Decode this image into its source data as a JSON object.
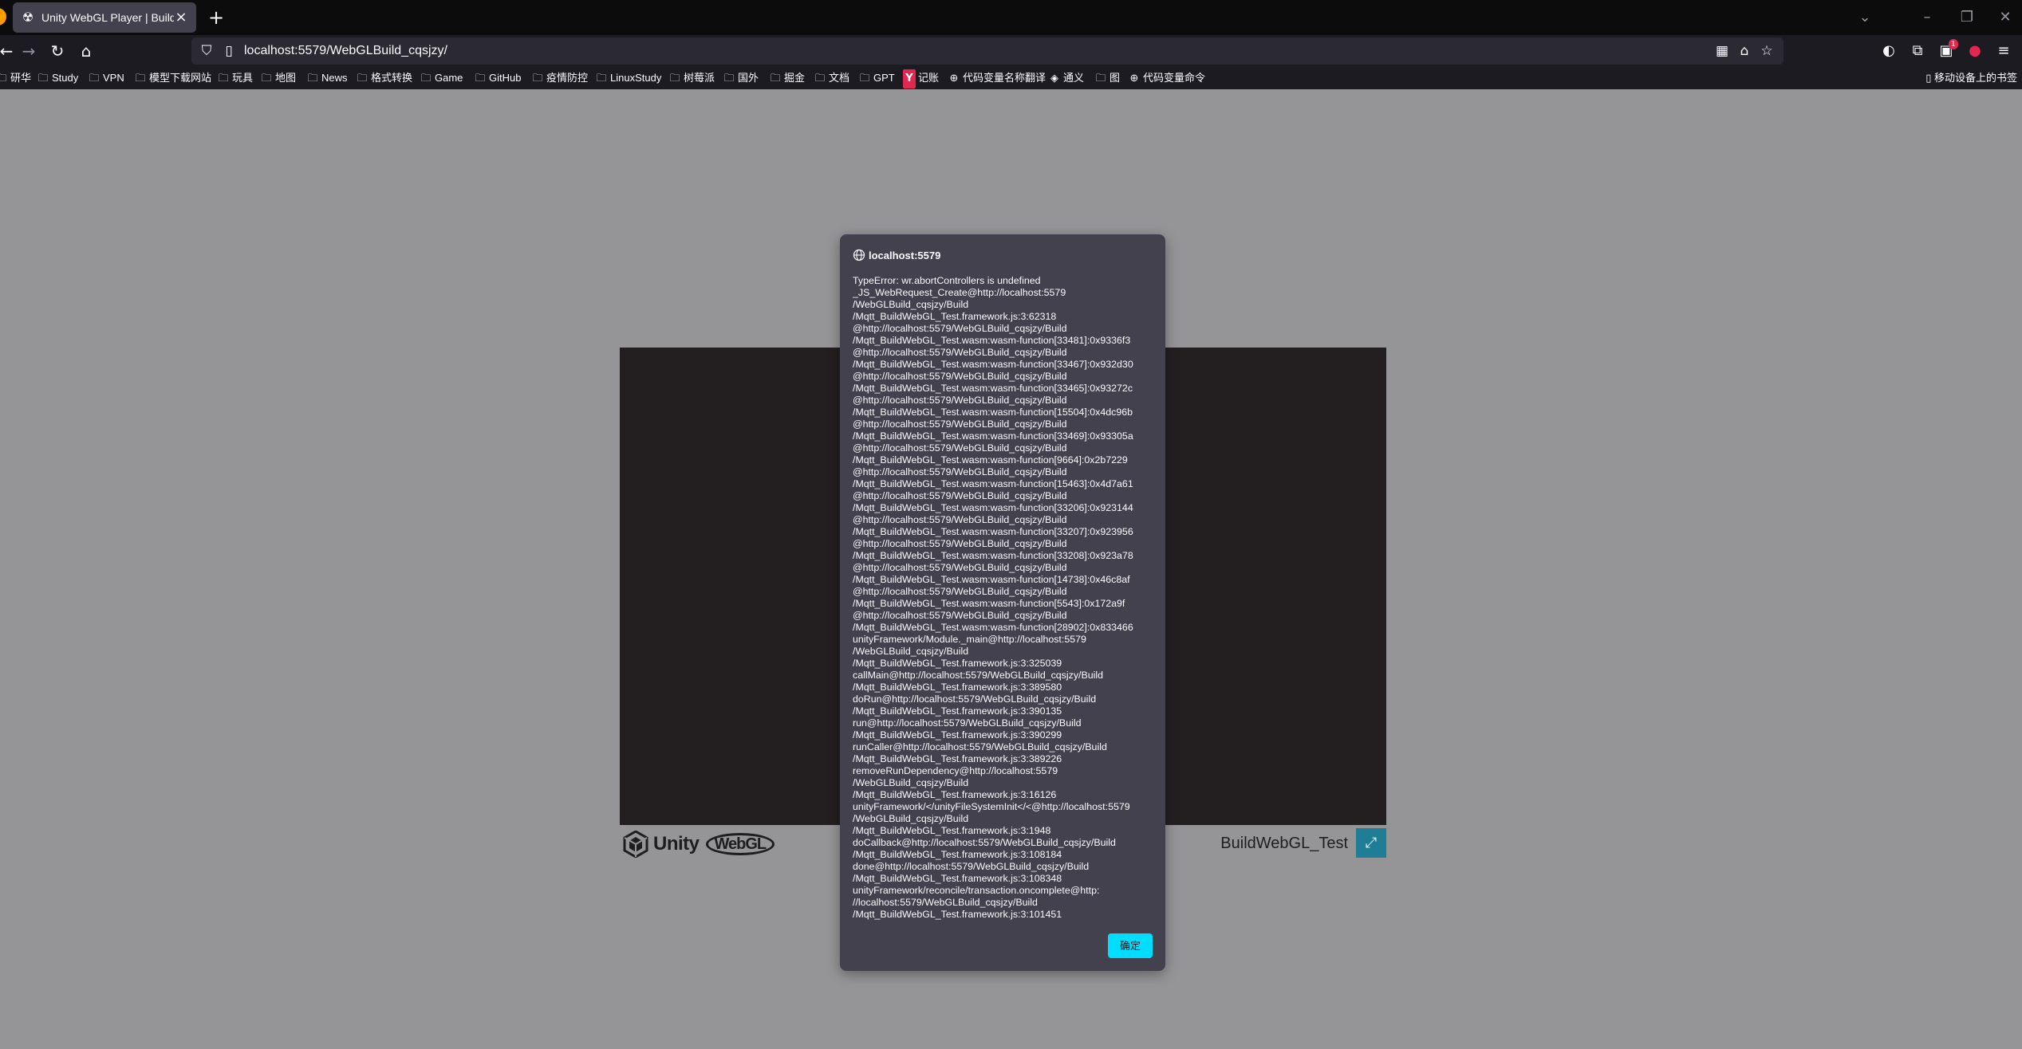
{
  "browser": {
    "tab": {
      "title": "Unity WebGL Player | BuildWebGL_Test",
      "favicon": "unity-icon"
    },
    "url": "localhost:5579/WebGLBuild_cqsjzy/",
    "toolbar_badge": "1",
    "bookmarks": [
      {
        "label": "研华",
        "icon": "folder-icon"
      },
      {
        "label": "Study",
        "icon": "folder-icon"
      },
      {
        "label": "VPN",
        "icon": "folder-icon"
      },
      {
        "label": "模型下载网站",
        "icon": "folder-icon"
      },
      {
        "label": "玩具",
        "icon": "folder-icon"
      },
      {
        "label": "地图",
        "icon": "folder-icon"
      },
      {
        "label": "News",
        "icon": "folder-icon"
      },
      {
        "label": "格式转换",
        "icon": "folder-icon"
      },
      {
        "label": "Game",
        "icon": "folder-icon"
      },
      {
        "label": "GitHub",
        "icon": "folder-icon"
      },
      {
        "label": "疫情防控",
        "icon": "folder-icon"
      },
      {
        "label": "LinuxStudy",
        "icon": "folder-icon"
      },
      {
        "label": "树莓派",
        "icon": "folder-icon"
      },
      {
        "label": "国外",
        "icon": "folder-icon"
      },
      {
        "label": "掘金",
        "icon": "folder-icon"
      },
      {
        "label": "文档",
        "icon": "folder-icon"
      },
      {
        "label": "GPT",
        "icon": "folder-icon"
      },
      {
        "label": "记账",
        "icon": "y-icon"
      },
      {
        "label": "代码变量名称翻译",
        "icon": "globe-icon"
      },
      {
        "label": "通义",
        "icon": "tongyi-icon"
      },
      {
        "label": "图",
        "icon": "folder-icon"
      },
      {
        "label": "代码变量命令",
        "icon": "globe-icon"
      }
    ],
    "mobile_bookmarks": "移动设备上的书签"
  },
  "page": {
    "unity_text": "Unity",
    "webgl_text": "WebGL",
    "build_title": "BuildWebGL_Test"
  },
  "dialog": {
    "title": "localhost:5579",
    "message": "TypeError: wr.abortControllers is undefined\n_JS_WebRequest_Create@http://localhost:5579\n/WebGLBuild_cqsjzy/Build\n/Mqtt_BuildWebGL_Test.framework.js:3:62318\n@http://localhost:5579/WebGLBuild_cqsjzy/Build\n/Mqtt_BuildWebGL_Test.wasm:wasm-function[33481]:0x9336f3\n@http://localhost:5579/WebGLBuild_cqsjzy/Build\n/Mqtt_BuildWebGL_Test.wasm:wasm-function[33467]:0x932d30\n@http://localhost:5579/WebGLBuild_cqsjzy/Build\n/Mqtt_BuildWebGL_Test.wasm:wasm-function[33465]:0x93272c\n@http://localhost:5579/WebGLBuild_cqsjzy/Build\n/Mqtt_BuildWebGL_Test.wasm:wasm-function[15504]:0x4dc96b\n@http://localhost:5579/WebGLBuild_cqsjzy/Build\n/Mqtt_BuildWebGL_Test.wasm:wasm-function[33469]:0x93305a\n@http://localhost:5579/WebGLBuild_cqsjzy/Build\n/Mqtt_BuildWebGL_Test.wasm:wasm-function[9664]:0x2b7229\n@http://localhost:5579/WebGLBuild_cqsjzy/Build\n/Mqtt_BuildWebGL_Test.wasm:wasm-function[15463]:0x4d7a61\n@http://localhost:5579/WebGLBuild_cqsjzy/Build\n/Mqtt_BuildWebGL_Test.wasm:wasm-function[33206]:0x923144\n@http://localhost:5579/WebGLBuild_cqsjzy/Build\n/Mqtt_BuildWebGL_Test.wasm:wasm-function[33207]:0x923956\n@http://localhost:5579/WebGLBuild_cqsjzy/Build\n/Mqtt_BuildWebGL_Test.wasm:wasm-function[33208]:0x923a78\n@http://localhost:5579/WebGLBuild_cqsjzy/Build\n/Mqtt_BuildWebGL_Test.wasm:wasm-function[14738]:0x46c8af\n@http://localhost:5579/WebGLBuild_cqsjzy/Build\n/Mqtt_BuildWebGL_Test.wasm:wasm-function[5543]:0x172a9f\n@http://localhost:5579/WebGLBuild_cqsjzy/Build\n/Mqtt_BuildWebGL_Test.wasm:wasm-function[28902]:0x833466\nunityFramework/Module._main@http://localhost:5579\n/WebGLBuild_cqsjzy/Build\n/Mqtt_BuildWebGL_Test.framework.js:3:325039\ncallMain@http://localhost:5579/WebGLBuild_cqsjzy/Build\n/Mqtt_BuildWebGL_Test.framework.js:3:389580\ndoRun@http://localhost:5579/WebGLBuild_cqsjzy/Build\n/Mqtt_BuildWebGL_Test.framework.js:3:390135\nrun@http://localhost:5579/WebGLBuild_cqsjzy/Build\n/Mqtt_BuildWebGL_Test.framework.js:3:390299\nrunCaller@http://localhost:5579/WebGLBuild_cqsjzy/Build\n/Mqtt_BuildWebGL_Test.framework.js:3:389226\nremoveRunDependency@http://localhost:5579\n/WebGLBuild_cqsjzy/Build\n/Mqtt_BuildWebGL_Test.framework.js:3:16126\nunityFramework/</unityFileSystemInit</<@http://localhost:5579\n/WebGLBuild_cqsjzy/Build\n/Mqtt_BuildWebGL_Test.framework.js:3:1948\ndoCallback@http://localhost:5579/WebGLBuild_cqsjzy/Build\n/Mqtt_BuildWebGL_Test.framework.js:3:108184\ndone@http://localhost:5579/WebGLBuild_cqsjzy/Build\n/Mqtt_BuildWebGL_Test.framework.js:3:108348\nunityFramework/reconcile/transaction.oncomplete@http:\n//localhost:5579/WebGLBuild_cqsjzy/Build\n/Mqtt_BuildWebGL_Test.framework.js:3:101451",
    "ok_label": "确定"
  },
  "colors": {
    "page_background": "#959497",
    "canvas_background": "#231f20",
    "dialog_background": "#42414d",
    "ok_button": "#00ddff",
    "fullscreen_button": "#1f7d96"
  }
}
